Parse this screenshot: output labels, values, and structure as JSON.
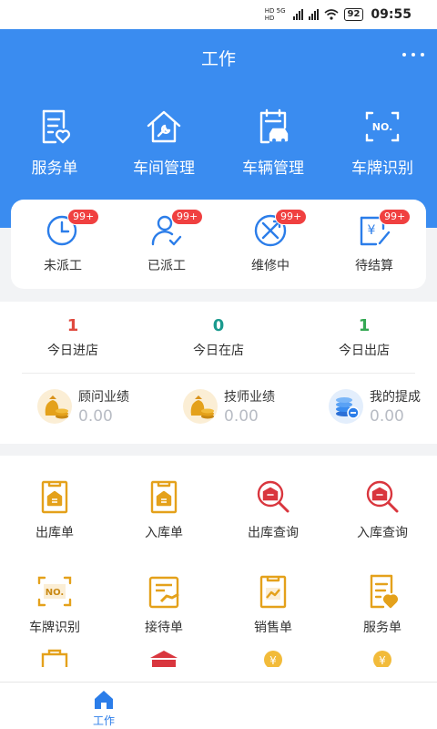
{
  "status_bar": {
    "net_top": "HD 5G",
    "net_bottom": "HD",
    "battery": "92",
    "time": "09:55"
  },
  "header": {
    "title": "工作",
    "nav": [
      {
        "label": "服务单",
        "icon": "service-order-icon"
      },
      {
        "label": "车间管理",
        "icon": "workshop-icon"
      },
      {
        "label": "车辆管理",
        "icon": "vehicle-icon"
      },
      {
        "label": "车牌识别",
        "icon": "plate-recognition-icon"
      }
    ]
  },
  "orders": [
    {
      "label": "未派工",
      "badge": "99+"
    },
    {
      "label": "已派工",
      "badge": "99+"
    },
    {
      "label": "维修中",
      "badge": "99+"
    },
    {
      "label": "待结算",
      "badge": "99+"
    }
  ],
  "stats": [
    {
      "value": "1",
      "label": "今日进店",
      "color": "#e04a3f"
    },
    {
      "value": "0",
      "label": "今日在店",
      "color": "#1a9a8e"
    },
    {
      "value": "1",
      "label": "今日出店",
      "color": "#34a853"
    }
  ],
  "performance": [
    {
      "label": "顾问业绩",
      "value": "0.00"
    },
    {
      "label": "技师业绩",
      "value": "0.00"
    },
    {
      "label": "我的提成",
      "value": "0.00"
    }
  ],
  "grid": [
    {
      "label": "出库单",
      "icon": "outbound-order-icon"
    },
    {
      "label": "入库单",
      "icon": "inbound-order-icon"
    },
    {
      "label": "出库查询",
      "icon": "outbound-query-icon"
    },
    {
      "label": "入库查询",
      "icon": "inbound-query-icon"
    },
    {
      "label": "车牌识别",
      "icon": "plate-recognition-icon"
    },
    {
      "label": "接待单",
      "icon": "reception-order-icon"
    },
    {
      "label": "销售单",
      "icon": "sales-order-icon"
    },
    {
      "label": "服务单",
      "icon": "service-order-icon"
    }
  ],
  "tabbar": {
    "home_label": "工作"
  },
  "colors": {
    "primary": "#3a8cf0",
    "badge": "#f04040",
    "gold": "#e4a11b",
    "red_icon": "#d9363e",
    "muted": "#b8bcc4"
  }
}
